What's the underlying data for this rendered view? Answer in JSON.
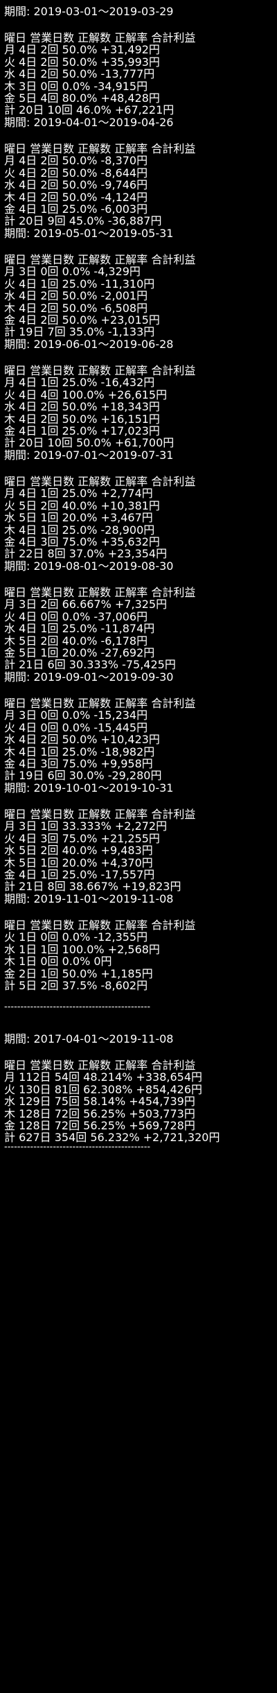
{
  "colors": {
    "background": "#000000",
    "text": "#ffffff"
  },
  "period_label": "期間: ",
  "header": "曜日 営業日数 正解数 正解率 合計利益",
  "sections": [
    {
      "period": "2019-03-01～2019-03-29",
      "rows": [
        "月 4日 2回 50.0% +31,492円",
        "火 4日 2回 50.0% +35,993円",
        "水 4日 2回 50.0% -13,777円",
        "木 3日 0回 0.0% -34,915円",
        "金 5日 4回 80.0% +48,428円",
        "計 20日 10回 46.0% +67,221円"
      ]
    },
    {
      "period": "2019-04-01～2019-04-26",
      "rows": [
        "月 4日 2回 50.0% -8,370円",
        "火 4日 2回 50.0% -8,644円",
        "水 4日 2回 50.0% -9,746円",
        "木 4日 2回 50.0% -4,124円",
        "金 4日 1回 25.0% -6,003円",
        "計 20日 9回 45.0% -36,887円"
      ]
    },
    {
      "period": "2019-05-01～2019-05-31",
      "rows": [
        "月 3日 0回 0.0% -4,329円",
        "火 4日 1回 25.0% -11,310円",
        "水 4日 2回 50.0% -2,001円",
        "木 4日 2回 50.0% -6,508円",
        "金 4日 2回 50.0% +23,015円",
        "計 19日 7回 35.0% -1,133円"
      ]
    },
    {
      "period": "2019-06-01～2019-06-28",
      "rows": [
        "月 4日 1回 25.0% -16,432円",
        "火 4日 4回 100.0% +26,615円",
        "水 4日 2回 50.0% +18,343円",
        "木 4日 2回 50.0% +16,151円",
        "金 4日 1回 25.0% +17,023円",
        "計 20日 10回 50.0% +61,700円"
      ]
    },
    {
      "period": "2019-07-01～2019-07-31",
      "rows": [
        "月 4日 1回 25.0% +2,774円",
        "火 5日 2回 40.0% +10,381円",
        "水 5日 1回 20.0% +3,467円",
        "木 4日 1回 25.0% -28,900円",
        "金 4日 3回 75.0% +35,632円",
        "計 22日 8回 37.0% +23,354円"
      ]
    },
    {
      "period": "2019-08-01～2019-08-30",
      "rows": [
        "月 3日 2回 66.667% +7,325円",
        "火 4日 0回 0.0% -37,006円",
        "水 4日 1回 25.0% -11,874円",
        "木 5日 2回 40.0% -6,178円",
        "金 5日 1回 20.0% -27,692円",
        "計 21日 6回 30.333% -75,425円"
      ]
    },
    {
      "period": "2019-09-01～2019-09-30",
      "rows": [
        "月 3日 0回 0.0% -15,234円",
        "火 4日 0回 0.0% -15,445円",
        "水 4日 2回 50.0% +10,423円",
        "木 4日 1回 25.0% -18,982円",
        "金 4日 3回 75.0% +9,958円",
        "計 19日 6回 30.0% -29,280円"
      ]
    },
    {
      "period": "2019-10-01～2019-10-31",
      "rows": [
        "月 3日 1回 33.333% +2,272円",
        "火 4日 3回 75.0% +21,255円",
        "水 5日 2回 40.0% +9,483円",
        "木 5日 1回 20.0% +4,370円",
        "金 4日 1回 25.0% -17,557円",
        "計 21日 8回 38.667% +19,823円"
      ]
    },
    {
      "period": "2019-11-01～2019-11-08",
      "rows": [
        "火 1日 0回 0.0% -12,355円",
        "水 1日 1回 100.0% +2,568円",
        "木 1日 0回 0.0% 0円",
        "金 2日 1回 50.0% +1,185円",
        "計 5日 2回 37.5% -8,602円"
      ]
    }
  ],
  "divider": "---------------------------------------------",
  "total": {
    "period": "2017-04-01～2019-11-08",
    "rows": [
      "月 112日 54回 48.214% +338,654円",
      "火 130日 81回 62.308% +854,426円",
      "水 129日 75回 58.14% +454,739円",
      "木 128日 72回 56.25% +503,773円",
      "金 128日 72回 56.25% +569,728円",
      "計 627日 354回 56.232% +2,721,320円"
    ]
  }
}
